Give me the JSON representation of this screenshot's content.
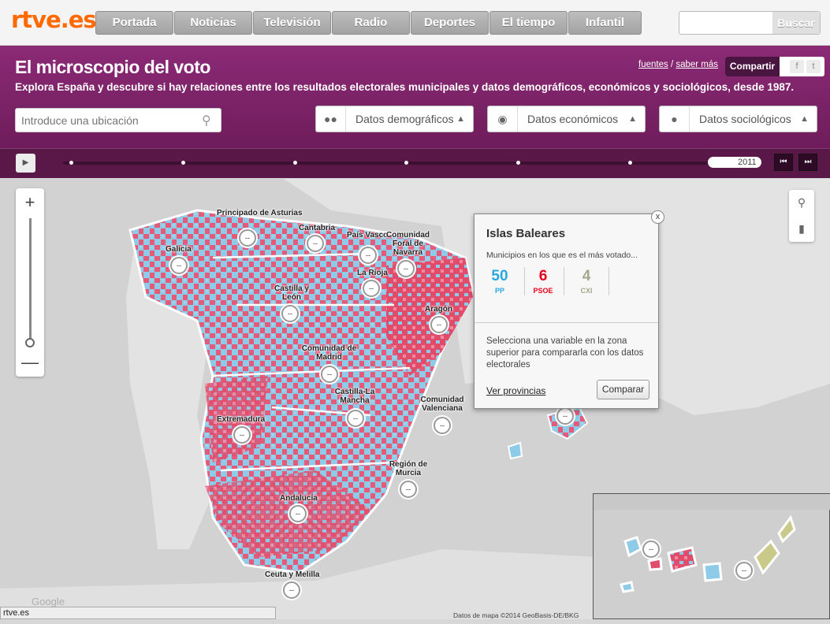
{
  "logo": {
    "main": "rtve",
    "tld": ".es"
  },
  "nav": [
    "Portada",
    "Noticias",
    "Televisión",
    "Radio",
    "Deportes",
    "El tiempo",
    "Infantil"
  ],
  "search": {
    "button": "Buscar",
    "value": ""
  },
  "header": {
    "title": "El microscopio del voto",
    "subtitle": "Explora España y descubre si hay relaciones entre los resultados electorales municipales y datos demográficos, económicos y sociológicos, desde 1987.",
    "link_sources": "fuentes",
    "link_separator": "/",
    "link_more": "saber más",
    "share": "Compartir",
    "share_facebook": "f",
    "share_twitter": "t"
  },
  "location": {
    "placeholder": "Introduce una ubicación"
  },
  "dropdowns": {
    "demographic": "Datos demográficos",
    "economic": "Datos económicos",
    "sociological": "Datos sociológicos"
  },
  "timeline": {
    "year": "2011"
  },
  "popup": {
    "title": "Islas Baleares",
    "subtitle": "Municipios en los que es el más votado...",
    "results": [
      {
        "value": "50",
        "party": "PP",
        "color": "#29a8e0"
      },
      {
        "value": "6",
        "party": "PSOE",
        "color": "#e3001b"
      },
      {
        "value": "4",
        "party": "CXI",
        "color": "#a3a88a"
      }
    ],
    "message": "Selecciona una variable en la zona superior para compararla con los datos electorales",
    "link": "Ver provincias",
    "button": "Comparar",
    "close": "x"
  },
  "regions": [
    "Principado de Asturias",
    "Cantabria",
    "País Vasco",
    "Comunidad Foral de Navarra",
    "Galicia",
    "La Rioja",
    "Castilla y León",
    "Aragón",
    "Comunidad de Madrid",
    "Castilla-La Mancha",
    "Extremadura",
    "Comunidad Valenciana",
    "Región de Murcia",
    "Andalucía",
    "Ceuta y Melilla"
  ],
  "marker_text": "--",
  "map": {
    "attribution": "Datos de mapa ©2014 GeoBasis-DE/BKG",
    "google": "Google"
  },
  "status_bar": "rtve.es"
}
